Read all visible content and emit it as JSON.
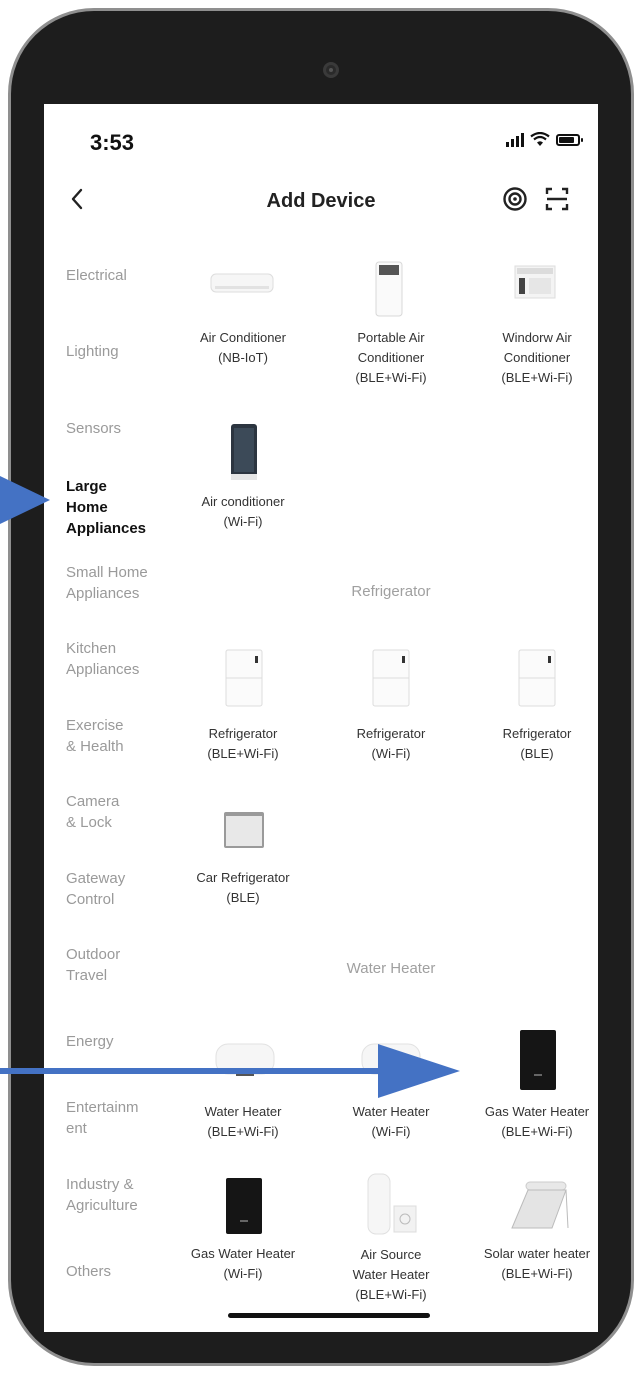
{
  "status": {
    "time": "3:53"
  },
  "header": {
    "title": "Add Device"
  },
  "categories": [
    "Electrical",
    "Lighting",
    "Sensors",
    "Large Home Appliances",
    "Small Home Appliances",
    "Kitchen Appliances",
    "Exercise & Health",
    "Camera & Lock",
    "Gateway Control",
    "Outdoor Travel",
    "Energy",
    "Entertainment",
    "Industry & Agriculture",
    "Others"
  ],
  "category_lines": {
    "c0": [
      "Electrical"
    ],
    "c1": [
      "Lighting"
    ],
    "c2": [
      "Sensors"
    ],
    "c3": [
      "Large",
      "Home",
      "Appliances"
    ],
    "c4": [
      "Small Home",
      "Appliances"
    ],
    "c5": [
      "Kitchen",
      "Appliances"
    ],
    "c6": [
      "Exercise",
      "& Health"
    ],
    "c7": [
      "Camera",
      "& Lock"
    ],
    "c8": [
      "Gateway",
      "Control"
    ],
    "c9": [
      "Outdoor",
      "Travel"
    ],
    "c10": [
      "Energy"
    ],
    "c11": [
      "Entertainm",
      "ent"
    ],
    "c12": [
      "Industry &",
      "Agriculture"
    ],
    "c13": [
      "Others"
    ]
  },
  "sections": {
    "refrigerator": "Refrigerator",
    "water_heater": "Water Heater"
  },
  "devices": {
    "d1": [
      "Air Conditioner",
      "(NB-IoT)"
    ],
    "d2": [
      "Portable Air",
      "Conditioner",
      "(BLE+Wi-Fi)"
    ],
    "d3": [
      "Windorw Air",
      "Conditioner",
      "(BLE+Wi-Fi)"
    ],
    "d4": [
      "Air conditioner",
      "(Wi-Fi)"
    ],
    "d5": [
      "Refrigerator",
      "(BLE+Wi-Fi)"
    ],
    "d6": [
      "Refrigerator",
      "(Wi-Fi)"
    ],
    "d7": [
      "Refrigerator",
      "(BLE)"
    ],
    "d8": [
      "Car Refrigerator",
      "(BLE)"
    ],
    "d9": [
      "Water Heater",
      "(BLE+Wi-Fi)"
    ],
    "d10": [
      "Water Heater",
      "(Wi-Fi)"
    ],
    "d11": [
      "Gas Water Heater",
      "(BLE+Wi-Fi)"
    ],
    "d12": [
      "Gas Water Heater",
      "(Wi-Fi)"
    ],
    "d13": [
      "Air Source",
      "Water Heater",
      "(BLE+Wi-Fi)"
    ],
    "d14": [
      "Solar water heater",
      "(BLE+Wi-Fi)"
    ]
  },
  "icons": {
    "back": "chevron-left-icon",
    "target": "target-icon",
    "scan": "scan-icon",
    "arrow": "annotation-arrow"
  },
  "colors": {
    "arrow": "#4472c4",
    "active_category": "#111111",
    "inactive_category": "#9a9a9a"
  }
}
